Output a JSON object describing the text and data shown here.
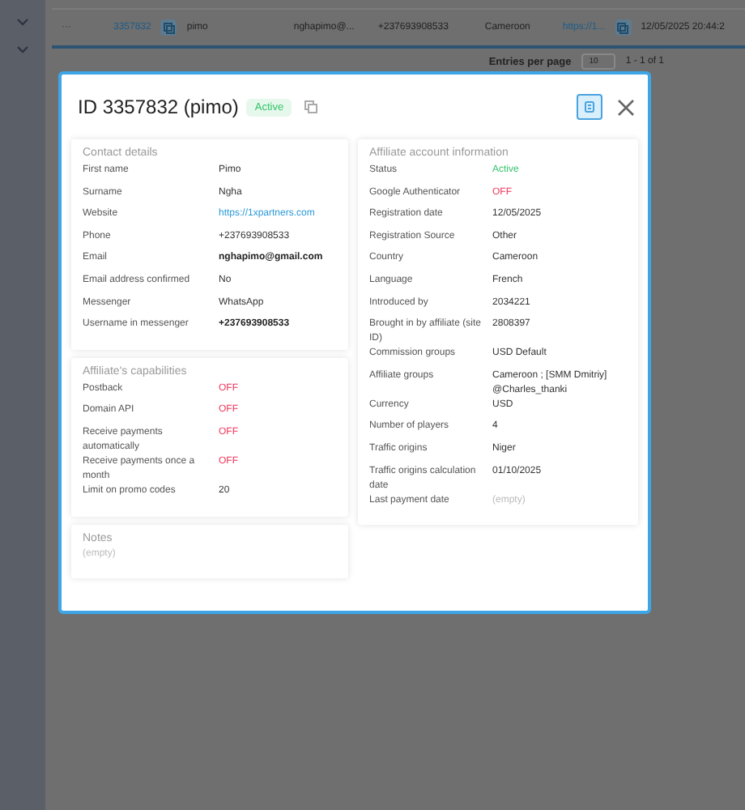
{
  "background_table": {
    "row": {
      "actions": "···",
      "id": "3357832",
      "login": "pimo",
      "email": "nghapimo@...",
      "phone": "+237693908533",
      "country": "Cameroon",
      "website": "https://1...",
      "registered": "12/05/2025 20:44:2"
    },
    "pagination": {
      "label": "Entries per page",
      "per_page": "10",
      "range": "1 - 1 of 1"
    }
  },
  "modal": {
    "title": "ID 3357832 (pimo)",
    "status_badge": "Active",
    "left_sections": [
      {
        "title": "Contact details",
        "rows": [
          {
            "label": "First name",
            "value": "Pimo",
            "kind": "plain"
          },
          {
            "label": "Surname",
            "value": "Ngha",
            "kind": "plain"
          },
          {
            "label": "Website",
            "value": "https://1xpartners.com",
            "kind": "link"
          },
          {
            "label": "Phone",
            "value": "+237693908533",
            "kind": "plain"
          },
          {
            "label": "Email",
            "value": "nghapimo@gmail.com",
            "kind": "strong"
          },
          {
            "label": "Email address confirmed",
            "value": "No",
            "kind": "plain"
          },
          {
            "label": "Messenger",
            "value": "WhatsApp",
            "kind": "plain"
          },
          {
            "label": "Username in messenger",
            "value": "+237693908533",
            "kind": "strong"
          }
        ]
      },
      {
        "title": "Affiliate's capabilities",
        "rows": [
          {
            "label": "Postback",
            "value": "OFF",
            "kind": "off"
          },
          {
            "label": "Domain API",
            "value": "OFF",
            "kind": "off"
          },
          {
            "label": "Receive payments automatically",
            "value": "OFF",
            "kind": "off"
          },
          {
            "label": "Receive payments once a month",
            "value": "OFF",
            "kind": "off"
          },
          {
            "label": "Limit on promo codes",
            "value": "20",
            "kind": "plain"
          }
        ]
      }
    ],
    "notes": {
      "title": "Notes",
      "text": "(empty)"
    },
    "right_section": {
      "title": "Affiliate account information",
      "rows": [
        {
          "label": "Status",
          "value": "Active",
          "kind": "on"
        },
        {
          "label": "Google Authenticator",
          "value": "OFF",
          "kind": "off"
        },
        {
          "label": "Registration date",
          "value": "12/05/2025",
          "kind": "plain"
        },
        {
          "label": "Registration Source",
          "value": "Other",
          "kind": "plain"
        },
        {
          "label": "Country",
          "value": "Cameroon",
          "kind": "plain"
        },
        {
          "label": "Language",
          "value": "French",
          "kind": "plain"
        },
        {
          "label": "Introduced by",
          "value": "2034221",
          "kind": "plain"
        },
        {
          "label": "Brought in by affiliate (site ID)",
          "value": "2808397",
          "kind": "plain"
        },
        {
          "label": "Commission groups",
          "value": "USD Default",
          "kind": "plain"
        },
        {
          "label": "Affiliate groups",
          "value": "Cameroon ; [SMM Dmitriy] @Charles_thanki",
          "kind": "plain"
        },
        {
          "label": "Currency",
          "value": "USD",
          "kind": "plain"
        },
        {
          "label": "Number of players",
          "value": "4",
          "kind": "plain"
        },
        {
          "label": "Traffic origins",
          "value": "Niger",
          "kind": "plain"
        },
        {
          "label": "Traffic origins calculation date",
          "value": "01/10/2025",
          "kind": "plain"
        },
        {
          "label": "Last payment date",
          "value": "(empty)",
          "kind": "empty"
        }
      ]
    }
  }
}
